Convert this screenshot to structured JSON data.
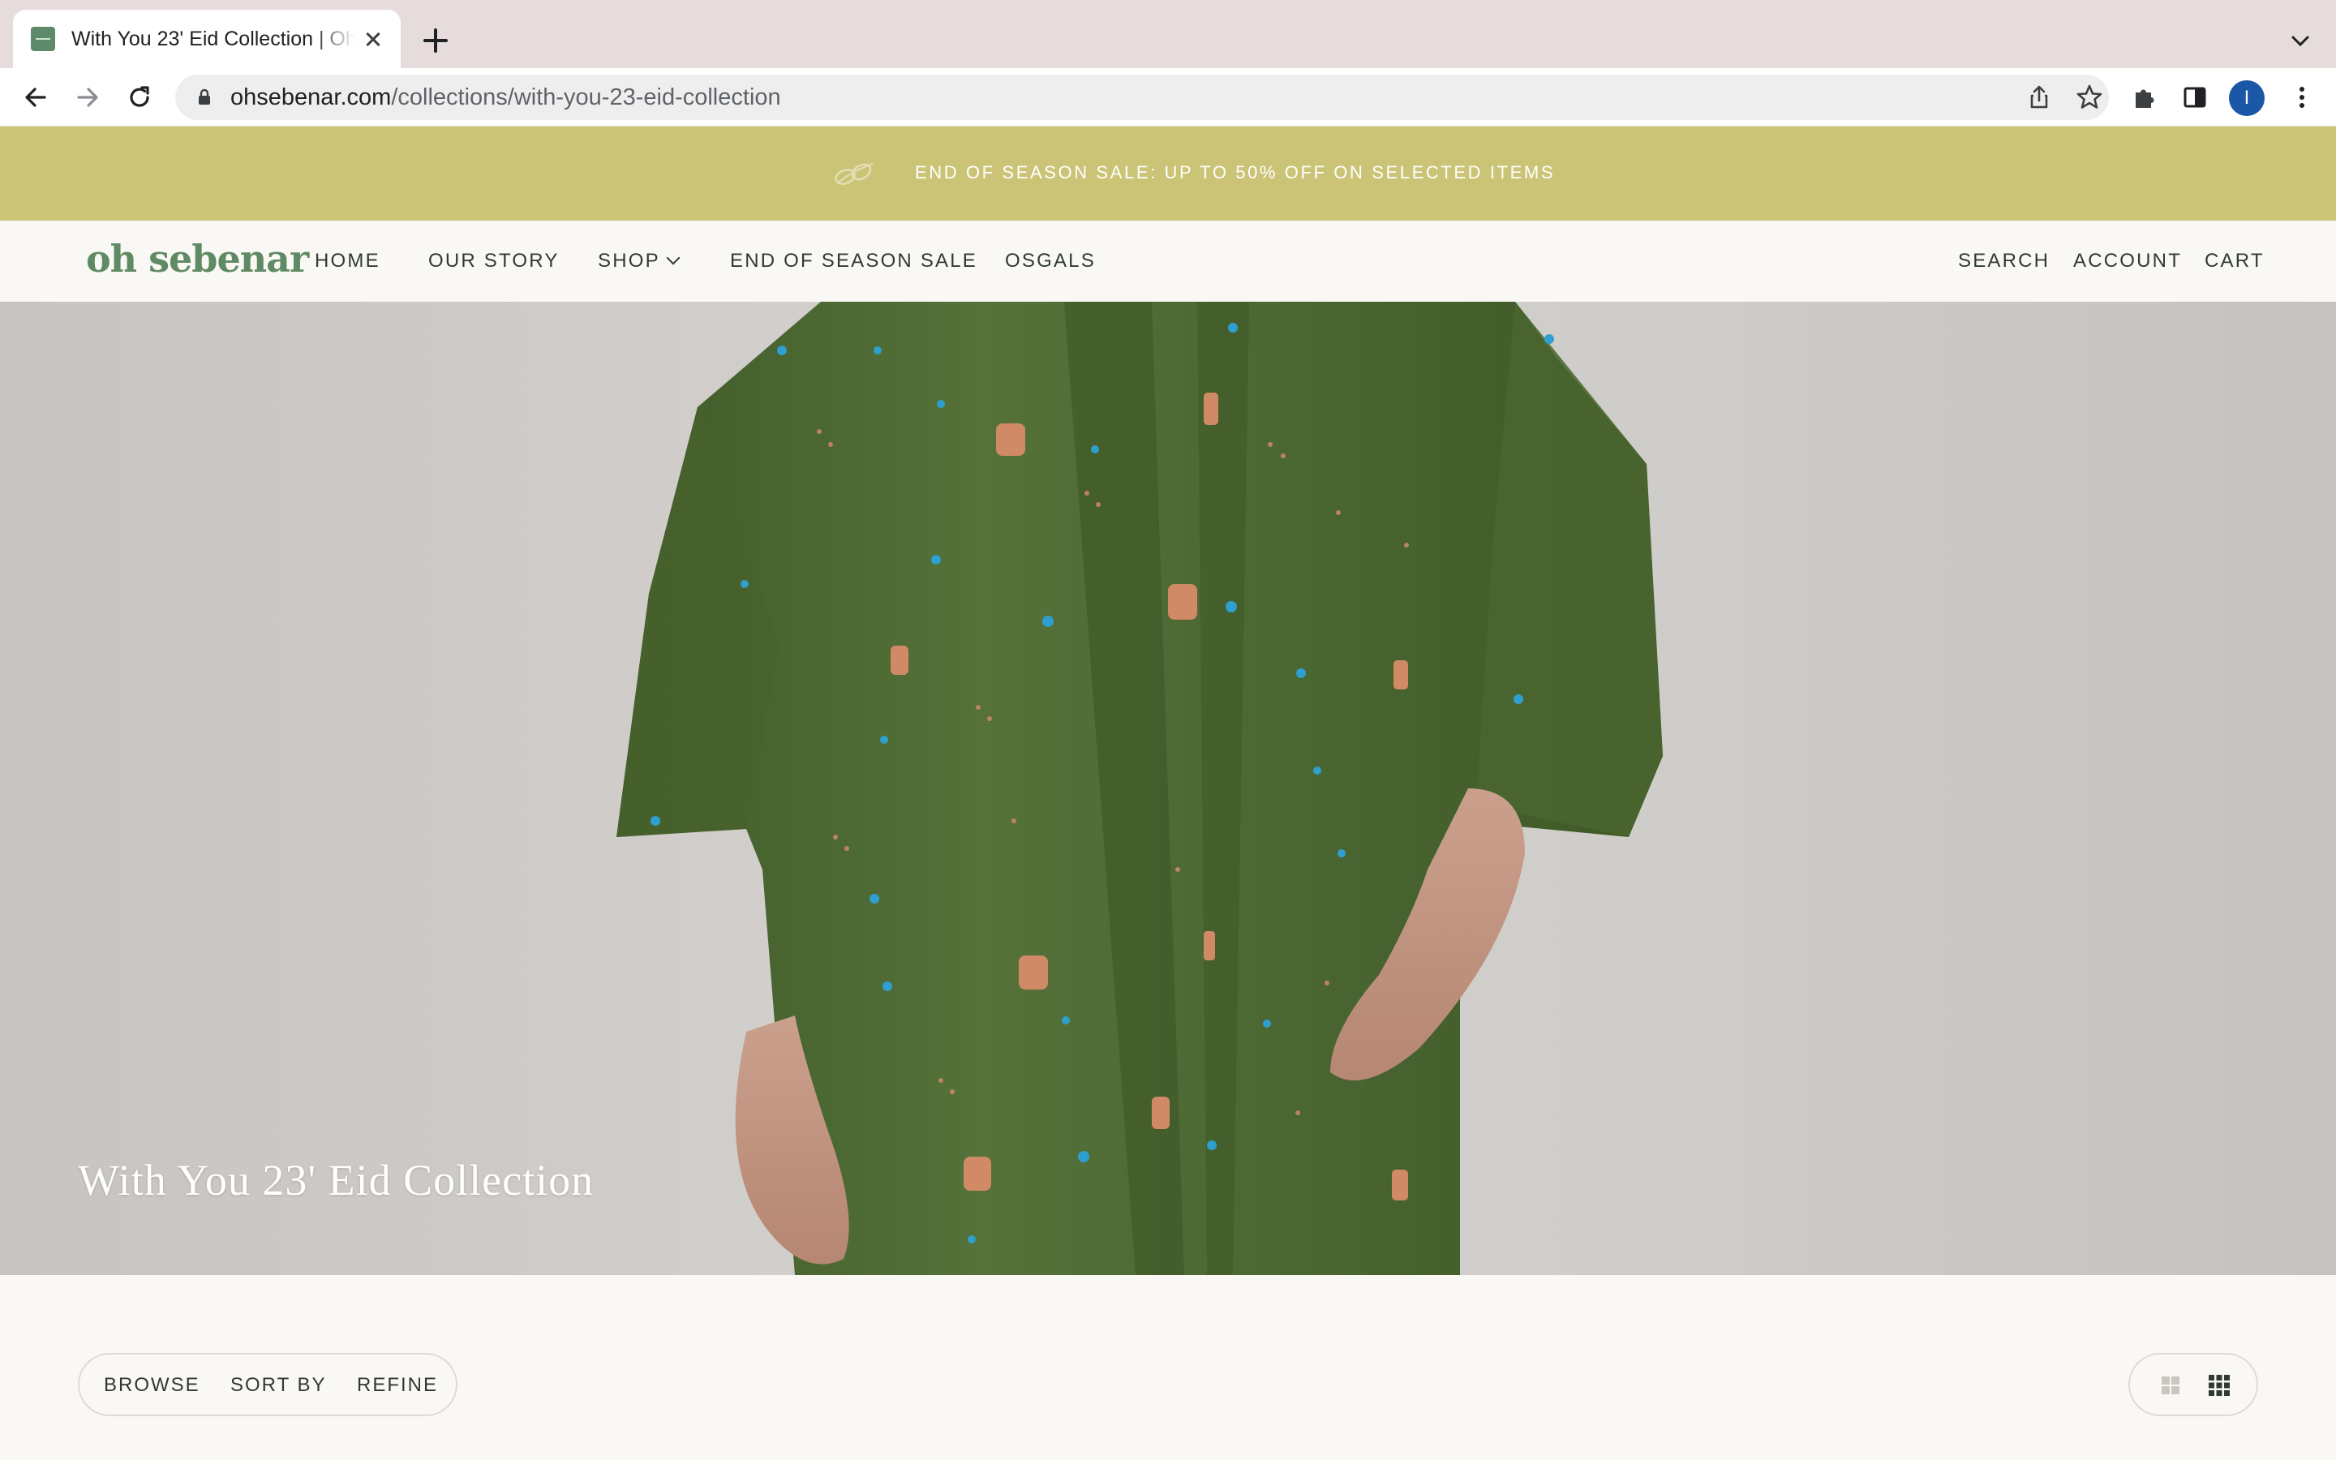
{
  "browser": {
    "tab_title": "With You 23' Eid Collection | Oh Sebenar",
    "url_host": "ohsebenar.com",
    "url_path": "/collections/with-you-23-eid-collection",
    "profile_initial": "I"
  },
  "announcement": {
    "text": "END OF SEASON SALE: UP TO 50% OFF ON SELECTED ITEMS"
  },
  "header": {
    "logo": "oh sebenar",
    "nav": [
      {
        "label": "HOME"
      },
      {
        "label": "OUR STORY"
      },
      {
        "label": "SHOP"
      },
      {
        "label": "END OF SEASON SALE"
      },
      {
        "label": "OSGALS"
      }
    ],
    "search_label": "SEARCH",
    "account_label": "ACCOUNT",
    "cart_label": "CART"
  },
  "hero": {
    "title": "With You 23' Eid Collection"
  },
  "filters": {
    "browse_label": "BROWSE",
    "sort_label": "SORT BY",
    "refine_label": "REFINE"
  },
  "colors": {
    "announcement_bg": "#cbc477",
    "brand_green": "#5f8a63",
    "garment_green": "#4f6a33"
  },
  "icons": {
    "back": "arrow-left-icon",
    "forward": "arrow-right-icon",
    "reload": "reload-icon",
    "share": "share-icon",
    "bookmark": "star-icon",
    "extensions": "puzzle-icon",
    "sidepanel": "side-panel-icon",
    "menu": "kebab-menu-icon",
    "grid_large": "grid-2x2-icon",
    "grid_small": "grid-3x3-icon"
  }
}
